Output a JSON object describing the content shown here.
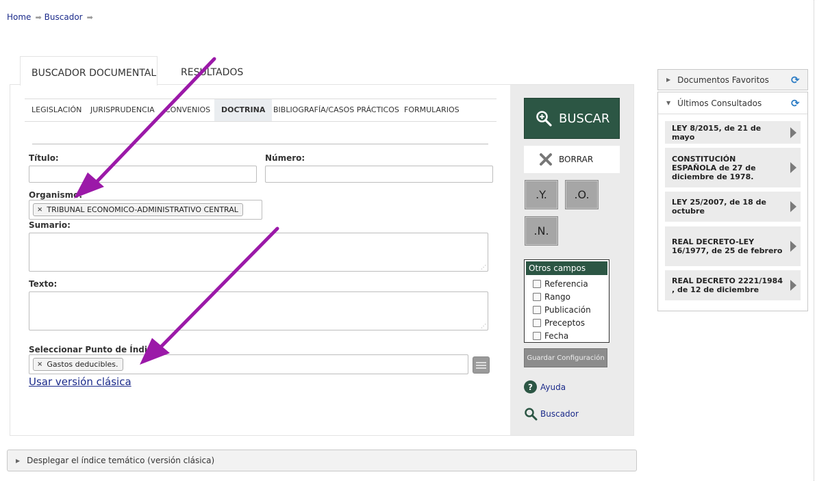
{
  "breadcrumb": {
    "home": "Home",
    "buscador": "Buscador"
  },
  "tabs": {
    "active": "BUSCADOR DOCUMENTAL",
    "second": "RESULTADOS"
  },
  "subtabs": [
    "LEGISLACIÓN",
    "JURISPRUDENCIA",
    "CONVENIOS",
    "DOCTRINA",
    "BIBLIOGRAFÍA/CASOS PRÁCTICOS",
    "FORMULARIOS"
  ],
  "active_subtab": "DOCTRINA",
  "form": {
    "titulo_label": "Título:",
    "numero_label": "Número:",
    "organismo_label": "Organismo:",
    "organismo_chip": "TRIBUNAL ECONOMICO-ADMINISTRATIVO CENTRAL",
    "sumario_label": "Sumario:",
    "texto_label": "Texto:",
    "indice_label": "Seleccionar Punto de Índice:",
    "indice_chip": "Gastos deducibles.",
    "chip_remove": "×",
    "classic_link": "Usar versión clásica"
  },
  "actions": {
    "buscar": "BUSCAR",
    "borrar": "BORRAR",
    "and": ".Y.",
    "or": ".O.",
    "not": ".N."
  },
  "otros_campos": {
    "title": "Otros campos",
    "items": [
      "Referencia",
      "Rango",
      "Publicación",
      "Preceptos",
      "Fecha"
    ]
  },
  "guardar": "Guardar Configuración",
  "ayuda": "Ayuda",
  "buscador_link": "Buscador",
  "indice_bar": "Desplegar el índice temático (versión clásica)",
  "sidebar": {
    "favoritos": "Documentos Favoritos",
    "ultimos": "Últimos Consultados",
    "docs": [
      "LEY 8/2015, de 21 de mayo",
      "CONSTITUCIÓN ESPAÑOLA de 27 de diciembre de 1978.",
      "LEY 25/2007, de 18 de octubre",
      "REAL DECRETO-LEY 16/1977, de 25 de febrero",
      "REAL DECRETO 2221/1984 , de 12 de diciembre"
    ]
  },
  "colors": {
    "accent_green": "#2c5644",
    "annotation_arrow": "#9b19a8",
    "link_blue": "#1a2a8a"
  },
  "icons": [
    "magnifier-plus-icon",
    "x-mark-icon",
    "question-icon",
    "search-icon",
    "refresh-icon",
    "triangle-right-icon",
    "triangle-down-icon",
    "arrow-right-icon",
    "list-icon"
  ]
}
